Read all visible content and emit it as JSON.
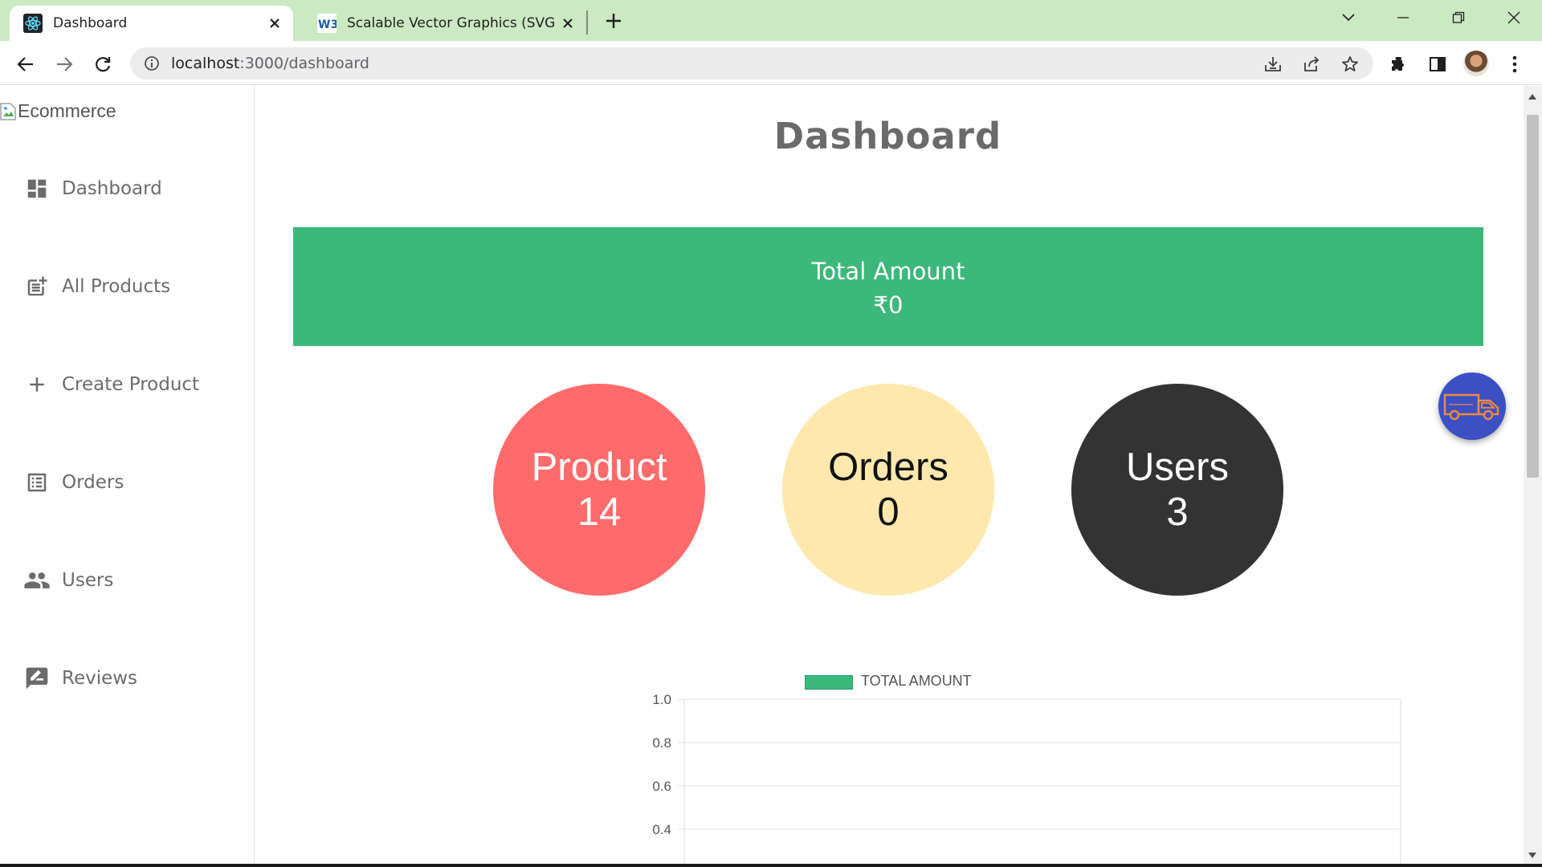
{
  "browser": {
    "tabs": [
      {
        "title": "Dashboard",
        "icon": "react-icon",
        "active": true
      },
      {
        "title": "Scalable Vector Graphics (SVG) 2",
        "icon": "w3c-icon",
        "active": false
      }
    ],
    "url_host": "localhost",
    "url_path": ":3000/dashboard"
  },
  "sidebar": {
    "brand_alt": "Ecommerce",
    "items": [
      {
        "label": "Dashboard",
        "icon": "dashboard-icon"
      },
      {
        "label": "All Products",
        "icon": "post-add-icon"
      },
      {
        "label": "Create Product",
        "icon": "add-icon"
      },
      {
        "label": "Orders",
        "icon": "list-alt-icon"
      },
      {
        "label": "Users",
        "icon": "people-icon"
      },
      {
        "label": "Reviews",
        "icon": "rate-review-icon"
      }
    ]
  },
  "main": {
    "title": "Dashboard",
    "total": {
      "label": "Total Amount",
      "value": "₹0"
    },
    "stats": [
      {
        "label": "Product",
        "value": "14"
      },
      {
        "label": "Orders",
        "value": "0"
      },
      {
        "label": "Users",
        "value": "3"
      }
    ]
  },
  "colors": {
    "accent_green": "#3db87b",
    "product": "#ff6b6b",
    "orders": "#fee8ae",
    "users": "#333333",
    "tab_strip": "#cbe9c2",
    "fab": "#3c50c4"
  },
  "chart_data": {
    "type": "line",
    "legend": [
      "TOTAL AMOUNT"
    ],
    "series": [
      {
        "name": "TOTAL AMOUNT",
        "values": []
      }
    ],
    "yticks": [
      "1.0",
      "0.8",
      "0.6",
      "0.4"
    ],
    "ylim": [
      0,
      1
    ],
    "grid": true,
    "legend_position": "top-center"
  }
}
